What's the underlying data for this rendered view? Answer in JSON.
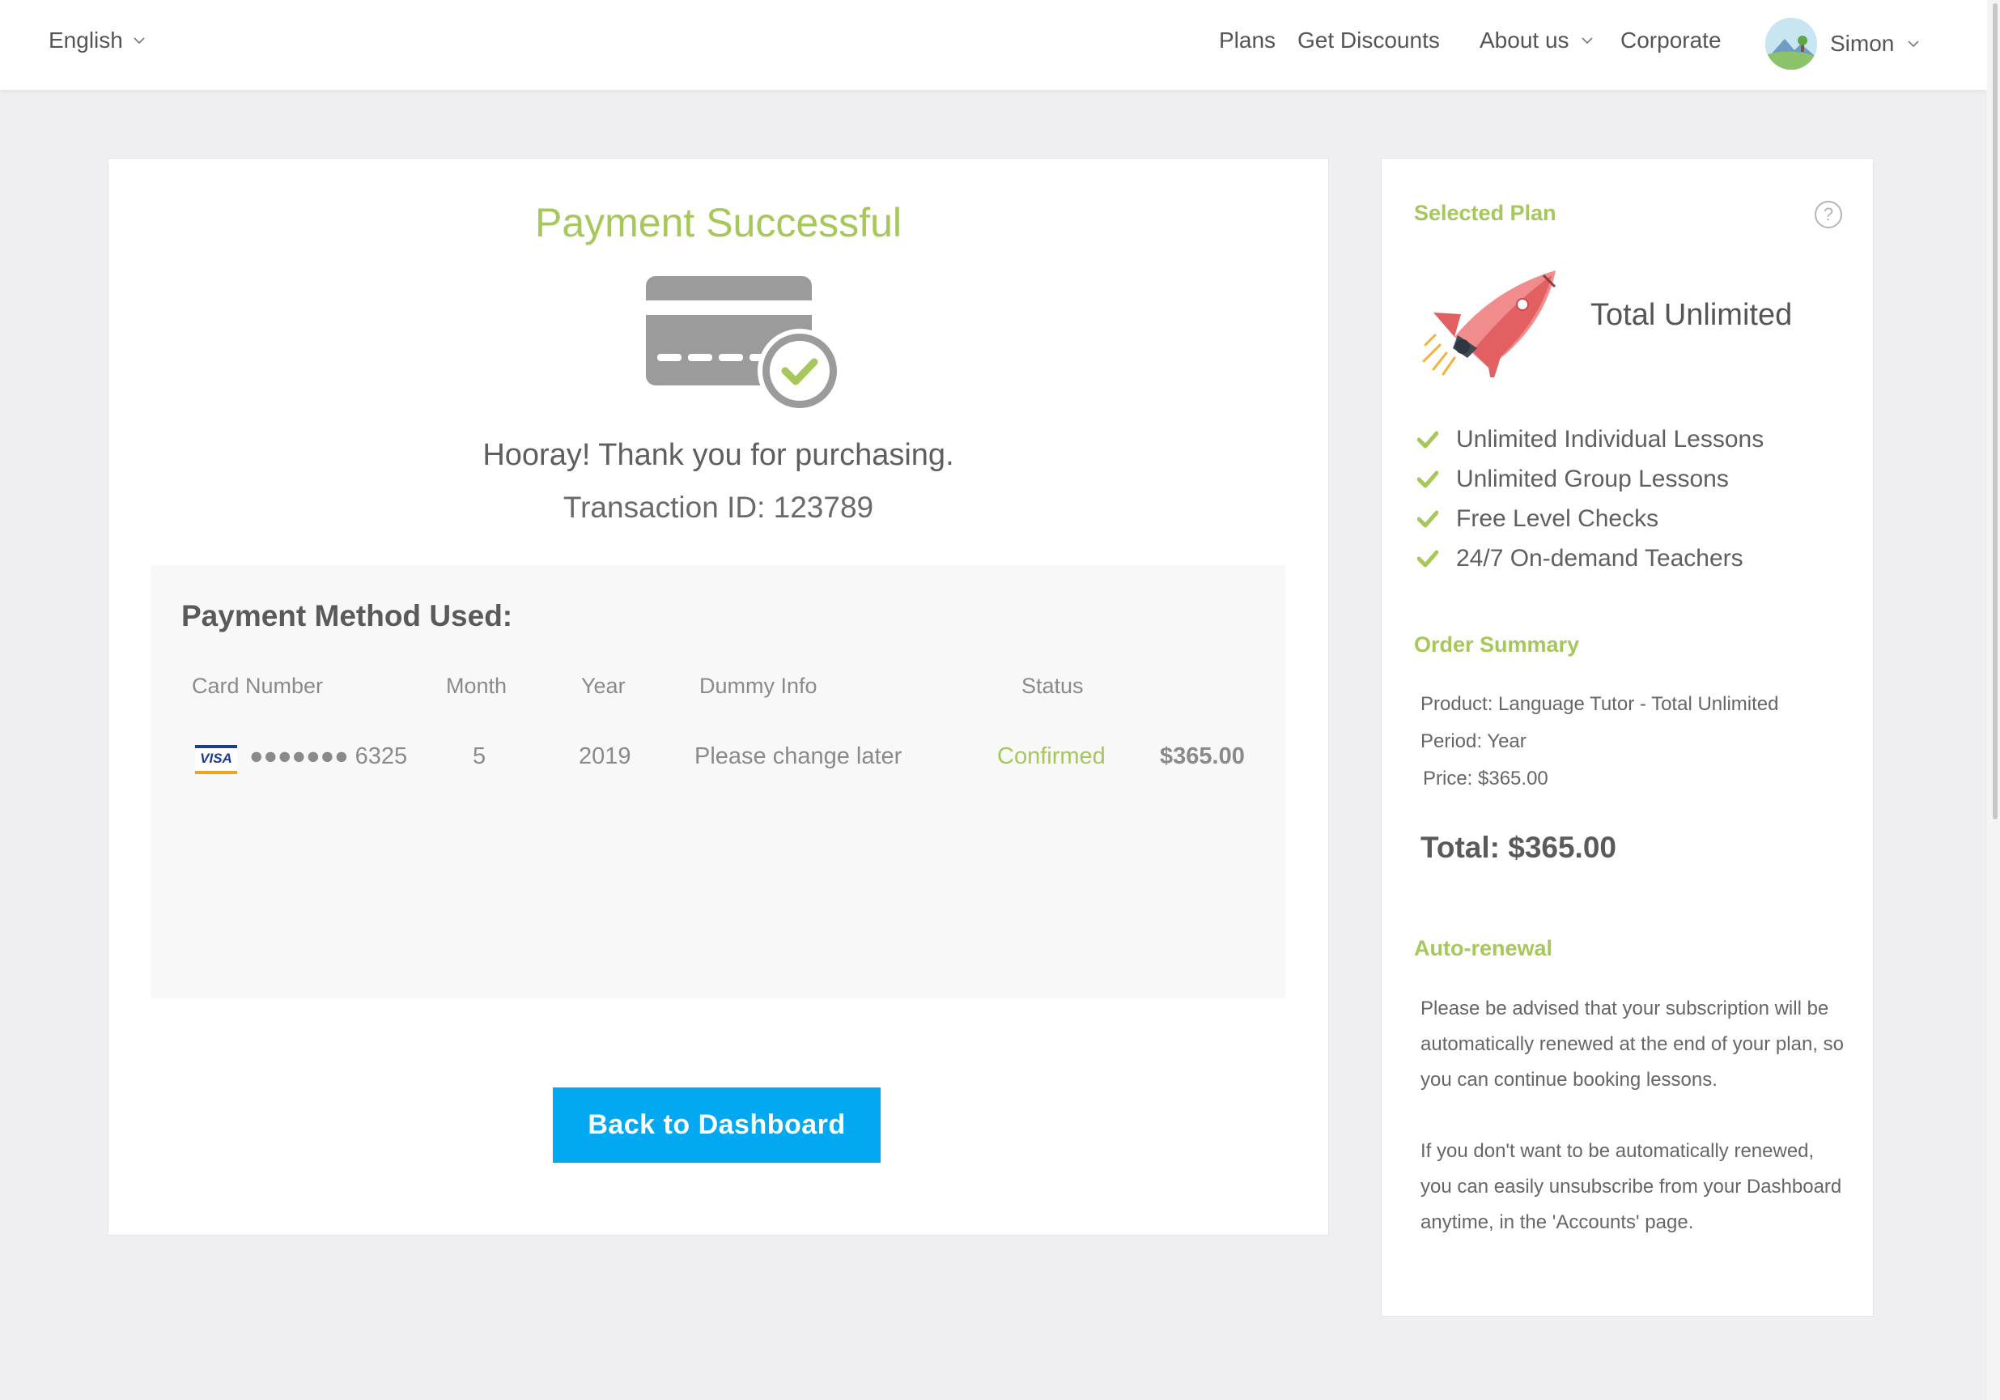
{
  "header": {
    "language": "English",
    "nav": {
      "plans": "Plans",
      "discounts": "Get Discounts",
      "about": "About us",
      "corporate": "Corporate"
    },
    "user_name": "Simon"
  },
  "main": {
    "title": "Payment Successful",
    "thanks": "Hooray! Thank you for purchasing.",
    "transaction": "Transaction ID: 123789",
    "payment": {
      "title": "Payment Method Used:",
      "columns": {
        "card": "Card Number",
        "month": "Month",
        "year": "Year",
        "dummy": "Dummy Info",
        "status": "Status"
      },
      "row": {
        "card_brand": "VISA",
        "card_number": "●●●●●●● 6325",
        "month": "5",
        "year": "2019",
        "dummy": "Please change later",
        "status": "Confirmed",
        "amount": "$365.00"
      }
    },
    "back_button": "Back to Dashboard"
  },
  "side": {
    "selected_plan_heading": "Selected Plan",
    "help": "?",
    "plan_name": "Total Unlimited",
    "features": [
      "Unlimited Individual Lessons",
      "Unlimited Group Lessons",
      "Free Level Checks",
      "24/7 On-demand Teachers"
    ],
    "order_heading": "Order Summary",
    "product": "Product: Language Tutor - Total Unlimited",
    "period": "Period: Year",
    "price": "Price: $365.00",
    "total": "Total: $365.00",
    "renewal_heading": "Auto-renewal",
    "renewal_text_1": "Please be advised that your subscription will be automatically renewed at the end of your plan, so you can continue booking lessons.",
    "renewal_text_2": "If you don't want to be automatically renewed, you can easily unsubscribe from your Dashboard anytime, in the 'Accounts' page."
  },
  "colors": {
    "accent_green": "#a6c759",
    "button_blue": "#03a9f0",
    "background": "#efeff1"
  },
  "icons": [
    "chevron-down-icon",
    "credit-card-check-icon",
    "visa-logo",
    "help-icon",
    "rocket-icon",
    "check-icon"
  ]
}
